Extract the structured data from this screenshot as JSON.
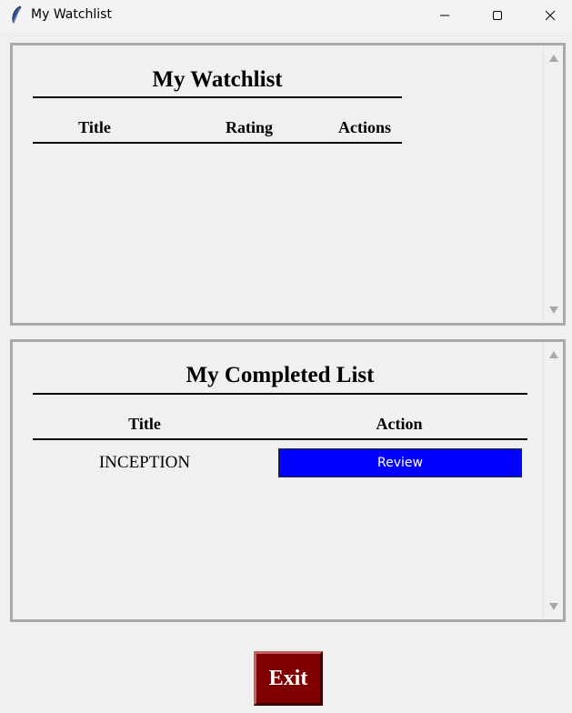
{
  "window": {
    "title": "My Watchlist"
  },
  "watchlist": {
    "heading": "My Watchlist",
    "columns": [
      "Title",
      "Rating",
      "Actions"
    ],
    "rows": []
  },
  "completed": {
    "heading": "My Completed List",
    "columns": [
      "Title",
      "Action"
    ],
    "rows": [
      {
        "title": "INCEPTION",
        "action_label": "Review"
      }
    ]
  },
  "footer": {
    "exit_label": "Exit"
  },
  "colors": {
    "review_button": "#0000ff",
    "exit_button": "#800000",
    "background": "#f0f0f0"
  },
  "icons": {
    "app": "feather-icon",
    "minimize": "minimize-icon",
    "maximize": "maximize-icon",
    "close": "close-icon"
  }
}
